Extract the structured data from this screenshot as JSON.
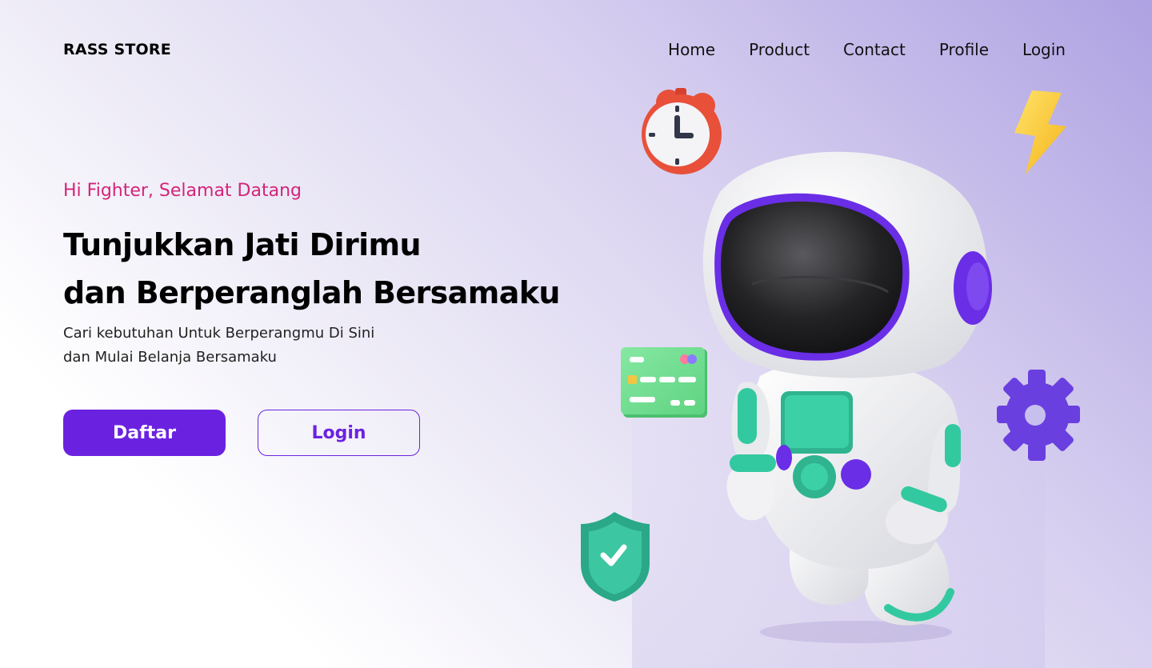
{
  "header": {
    "brand": "RASS STORE",
    "nav": [
      "Home",
      "Product",
      "Contact",
      "Profile",
      "Login"
    ]
  },
  "hero": {
    "eyebrow": "Hi Fighter, Selamat Datang",
    "headline": [
      "Tunjukkan Jati Dirimu",
      "dan Berperanglah Bersamaku"
    ],
    "subtitle": [
      "Cari kebutuhan Untuk Berperangmu Di Sini",
      "dan Mulai Belanja Bersamaku"
    ],
    "primary_button": "Daftar",
    "secondary_button": "Login"
  },
  "illustration": {
    "items": [
      "astronaut-icon",
      "alarm-clock-icon",
      "lightning-icon",
      "credit-card-icon",
      "gear-icon",
      "shield-check-icon"
    ]
  },
  "colors": {
    "accent": "#6b22e0",
    "eyebrow": "#d4247a",
    "teal": "#33c9a0",
    "purple": "#6a2ee6"
  }
}
